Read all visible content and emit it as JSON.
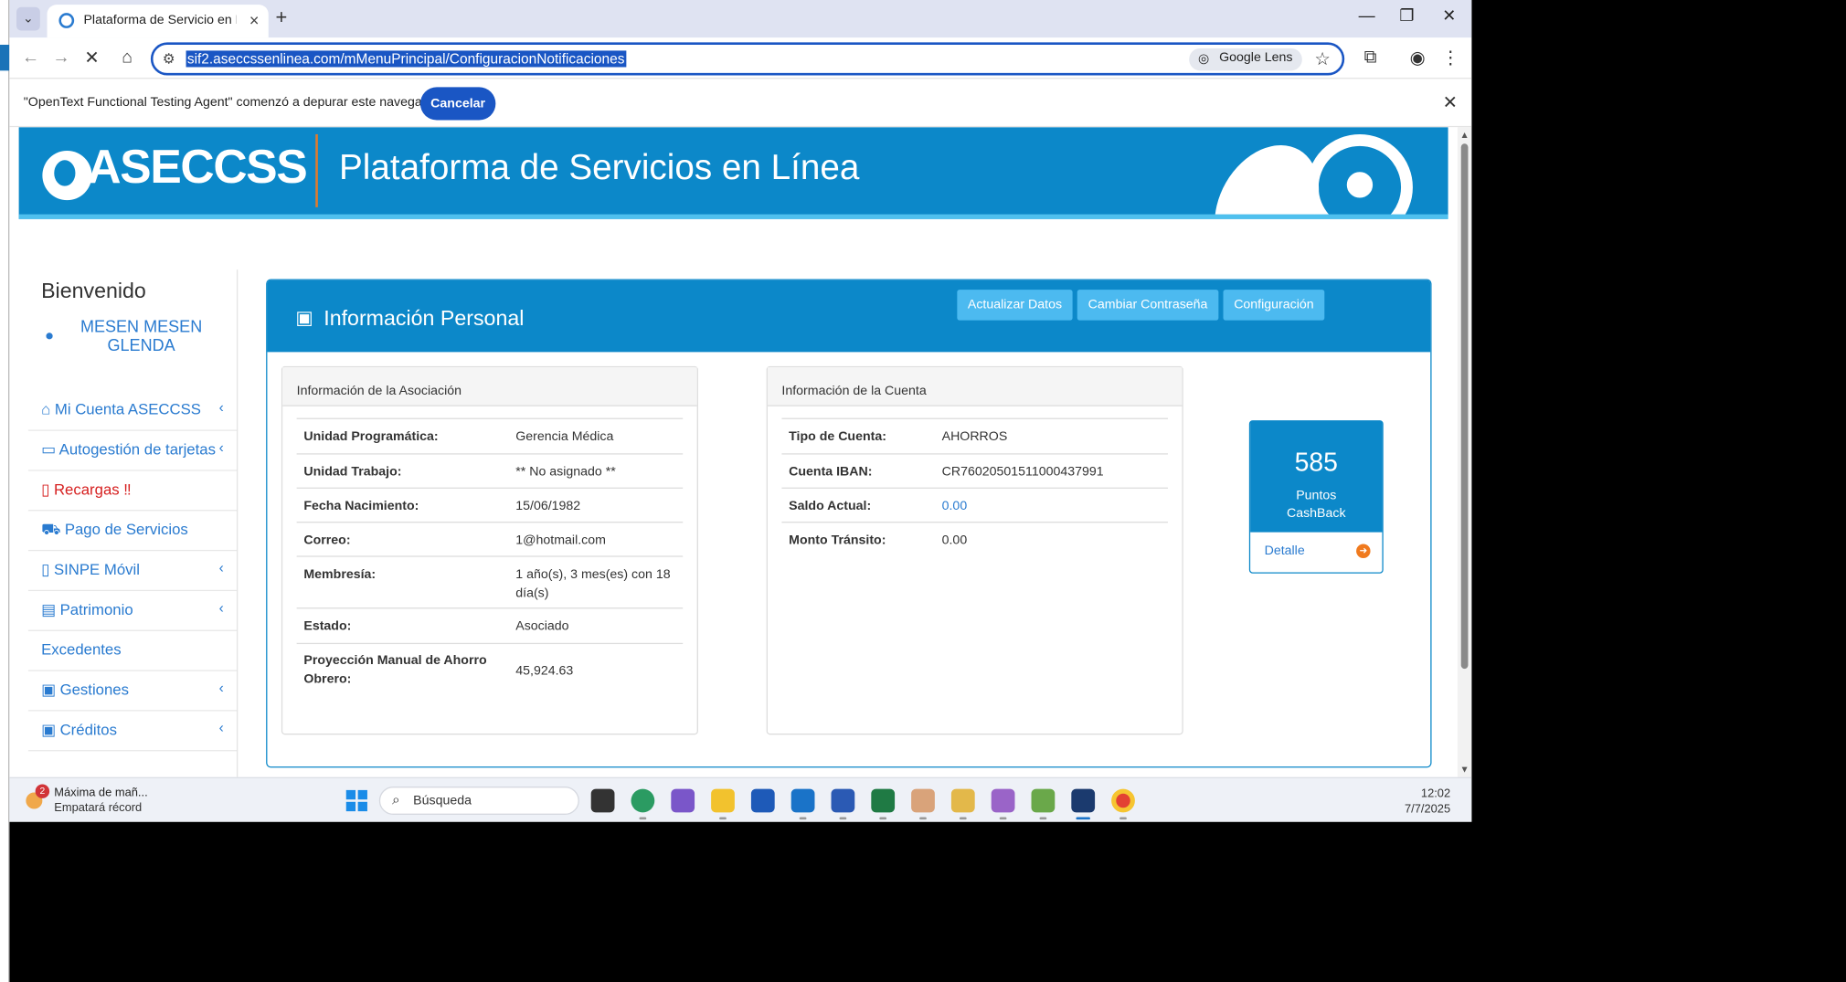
{
  "browser": {
    "tab_title": "Plataforma de Servicio en Línea",
    "url": "sif2.aseccssenlinea.com/mMenuPrincipal/ConfiguracionNotificaciones",
    "lens_label": "Google Lens"
  },
  "infobar": {
    "message": "\"OpenText Functional Testing Agent\" comenzó a depurar este navegador",
    "cancel_label": "Cancelar"
  },
  "banner": {
    "logo": "ASECCSS",
    "title": "Plataforma de Servicios en Línea"
  },
  "sidebar": {
    "welcome": "Bienvenido",
    "user_name": "MESEN MESEN GLENDA",
    "items": [
      {
        "label": "Mi Cuenta ASECCSS",
        "icon": "home-icon",
        "chevron": true
      },
      {
        "label": "Autogestión de tarjetas",
        "icon": "credit-card-icon",
        "chevron": true
      },
      {
        "label": "Recargas ‼",
        "icon": "mobile-icon",
        "chevron": false
      },
      {
        "label": "Pago de Servicios",
        "icon": "cart-icon",
        "chevron": false
      },
      {
        "label": "SINPE Móvil",
        "icon": "mobile-icon",
        "chevron": true
      },
      {
        "label": "Patrimonio",
        "icon": "id-card-icon",
        "chevron": true
      },
      {
        "label": "Excedentes",
        "icon": "",
        "chevron": false
      },
      {
        "label": "Gestiones",
        "icon": "briefcase-icon",
        "chevron": true
      },
      {
        "label": "Créditos",
        "icon": "money-icon",
        "chevron": true
      }
    ]
  },
  "panel": {
    "title": "Información Personal",
    "buttons": {
      "update": "Actualizar Datos",
      "password": "Cambiar Contraseña",
      "config": "Configuración"
    },
    "association": {
      "heading": "Información de la Asociación",
      "rows": [
        {
          "k": "Unidad Programática:",
          "v": "Gerencia Médica"
        },
        {
          "k": "Unidad Trabajo:",
          "v": "** No asignado **"
        },
        {
          "k": "Fecha Nacimiento:",
          "v": "15/06/1982"
        },
        {
          "k": "Correo:",
          "v": "1@hotmail.com"
        },
        {
          "k": "Membresía:",
          "v": "1 año(s), 3 mes(es) con 18 día(s)"
        },
        {
          "k": "Estado:",
          "v": "Asociado"
        },
        {
          "k": "Proyección Manual de Ahorro Obrero:",
          "v": "45,924.63"
        }
      ]
    },
    "account": {
      "heading": "Información de la Cuenta",
      "rows": [
        {
          "k": "Tipo de Cuenta:",
          "v": "AHORROS"
        },
        {
          "k": "Cuenta IBAN:",
          "v": "CR76020501511000437991"
        },
        {
          "k": "Saldo Actual:",
          "v": "0.00"
        },
        {
          "k": "Monto Tránsito:",
          "v": "0.00"
        }
      ]
    },
    "points": {
      "value": "585",
      "label": "Puntos CashBack",
      "detail": "Detalle"
    }
  },
  "taskbar": {
    "weather_line1": "Máxima de mañ...",
    "weather_line2": "Empatará récord",
    "weather_badge": "2",
    "search_placeholder": "Búsqueda",
    "time": "12:02",
    "date": "7/7/2025"
  },
  "colors": {
    "brand": "#0c88c9",
    "accent_light": "#4cbaf0",
    "link": "#2a7bd0",
    "alert": "#d62020"
  }
}
